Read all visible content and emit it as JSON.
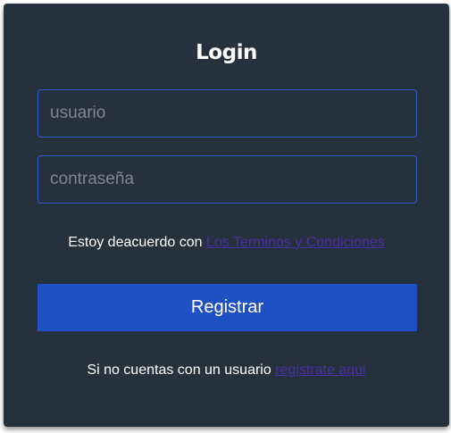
{
  "form": {
    "title": "Login",
    "username_placeholder": "usuario",
    "password_placeholder": "contraseña",
    "terms_prefix": "Estoy deacuerdo con ",
    "terms_link": "Los Terminos y Condiciones",
    "submit_label": "Registrar",
    "signup_prefix": "Si no cuentas con un usuario ",
    "signup_link": "registrate aqui"
  },
  "colors": {
    "card_background": "#25313d",
    "field_border": "#2f58c6",
    "button_background": "#1f50c4",
    "link": "#4a2ea3",
    "text": "#ffffff",
    "placeholder": "#7d8692"
  }
}
